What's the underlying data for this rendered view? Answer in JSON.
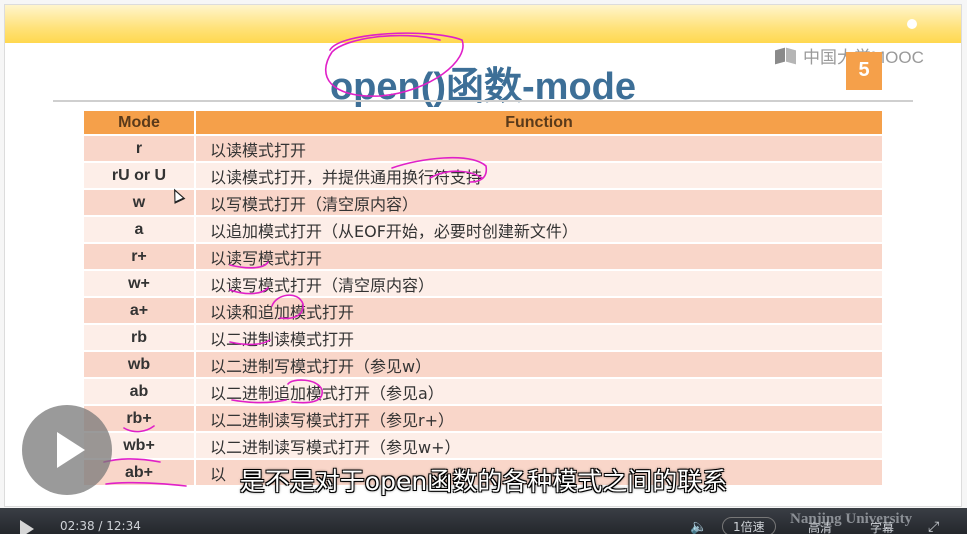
{
  "slide": {
    "title": "open()函数-mode",
    "page_number": "5",
    "logo_text": "中国大学MOOC",
    "table": {
      "headers": [
        "Mode",
        "Function"
      ],
      "rows": [
        {
          "mode": "r",
          "function": "以读模式打开"
        },
        {
          "mode": "rU or U",
          "function": "以读模式打开，并提供通用换行符支持"
        },
        {
          "mode": "w",
          "function": "以写模式打开（清空原内容）"
        },
        {
          "mode": "a",
          "function": "以追加模式打开（从EOF开始，必要时创建新文件）"
        },
        {
          "mode": "r+",
          "function": "以读写模式打开"
        },
        {
          "mode": "w+",
          "function": "以读写模式打开（清空原内容）"
        },
        {
          "mode": "a+",
          "function": "以读和追加模式打开"
        },
        {
          "mode": "rb",
          "function": "以二进制读模式打开"
        },
        {
          "mode": "wb",
          "function": "以二进制写模式打开（参见w）"
        },
        {
          "mode": "ab",
          "function": "以二进制追加模式打开（参见a）"
        },
        {
          "mode": "rb+",
          "function": "以二进制读写模式打开（参见r+）"
        },
        {
          "mode": "wb+",
          "function": "以二进制读写模式打开（参见w+）"
        },
        {
          "mode": "ab+",
          "function": "以"
        }
      ]
    }
  },
  "subtitle": "是不是对于open函数的各种模式之间的联系",
  "player": {
    "time": "02:38 / 12:34",
    "speed": "1倍速",
    "quality": "高清",
    "subtitles": "字幕",
    "watermark": "Nanjing University"
  },
  "colors": {
    "header_orange": "#f5a04a",
    "row_odd": "#f9d6c9",
    "row_even": "#fdeee8",
    "title_blue": "#3d6f97",
    "annotation_magenta": "#e020c8"
  }
}
